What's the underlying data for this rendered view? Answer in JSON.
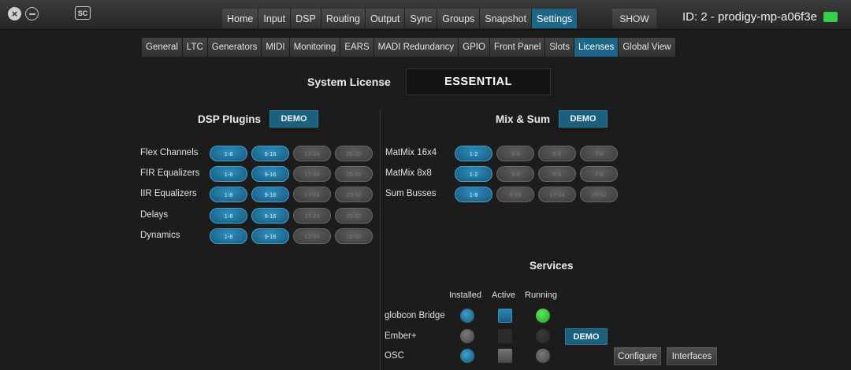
{
  "titlebar": {
    "logo": "SC",
    "nav": [
      "Home",
      "Input",
      "DSP",
      "Routing",
      "Output",
      "Sync",
      "Groups",
      "Snapshot",
      "Settings"
    ],
    "nav_active": "Settings",
    "show_label": "SHOW",
    "device_id": "ID: 2 - prodigy-mp-a06f3e",
    "status_color": "#35d04a"
  },
  "subnav": {
    "items": [
      "General",
      "LTC",
      "Generators",
      "MIDI",
      "Monitoring",
      "EARS",
      "MADI Redundancy",
      "GPIO",
      "Front Panel",
      "Slots",
      "Licenses",
      "Global View"
    ],
    "active": "Licenses"
  },
  "system_license": {
    "label": "System License",
    "value": "ESSENTIAL"
  },
  "dsp_plugins": {
    "title": "DSP Plugins",
    "badge": "DEMO",
    "ranges": [
      "1-8",
      "9-16",
      "17-24",
      "25-32"
    ],
    "rows": [
      {
        "label": "Flex Channels",
        "enabled": [
          true,
          true,
          false,
          false
        ]
      },
      {
        "label": "FIR Equalizers",
        "enabled": [
          true,
          true,
          false,
          false
        ]
      },
      {
        "label": "IIR Equalizers",
        "enabled": [
          true,
          true,
          false,
          false
        ]
      },
      {
        "label": "Delays",
        "enabled": [
          true,
          true,
          false,
          false
        ]
      },
      {
        "label": "Dynamics",
        "enabled": [
          true,
          true,
          false,
          false
        ]
      }
    ]
  },
  "mix_sum": {
    "title": "Mix & Sum",
    "badge": "DEMO",
    "rows": [
      {
        "label": "MatMix 16x4",
        "ranges": [
          "1-2",
          "3-4",
          "5-6",
          "7-8"
        ],
        "enabled": [
          true,
          false,
          false,
          false
        ]
      },
      {
        "label": "MatMix 8x8",
        "ranges": [
          "1-2",
          "3-4",
          "5-6",
          "7-8"
        ],
        "enabled": [
          true,
          false,
          false,
          false
        ]
      },
      {
        "label": "Sum Busses",
        "ranges": [
          "1-8",
          "9-16",
          "17-24",
          "25-32"
        ],
        "enabled": [
          true,
          false,
          false,
          false
        ]
      }
    ]
  },
  "services": {
    "title": "Services",
    "columns": [
      "Installed",
      "Active",
      "Running"
    ],
    "rows": [
      {
        "label": "globcon Bridge",
        "installed": "blue",
        "active": "blue",
        "running": "green"
      },
      {
        "label": "Ember+",
        "installed": "grey",
        "active": "dark",
        "running": "dark",
        "badge": "DEMO"
      },
      {
        "label": "OSC",
        "installed": "blue",
        "active": "grey",
        "running": "grey"
      }
    ],
    "configure_label": "Configure",
    "interfaces_label": "Interfaces"
  },
  "colors": {
    "accent": "#1d6688",
    "background": "#1c1c1c",
    "running": "#35d04a"
  }
}
